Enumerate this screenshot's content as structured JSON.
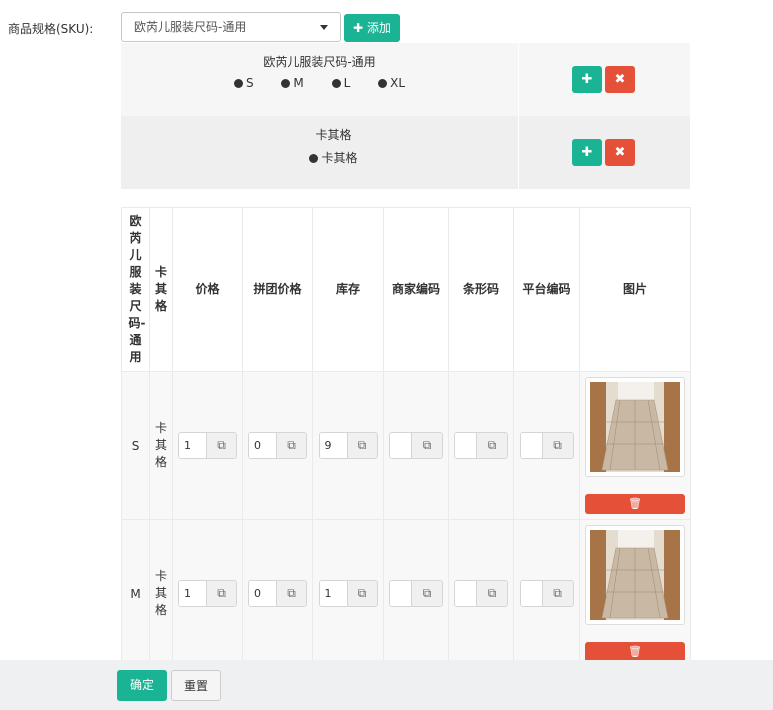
{
  "form": {
    "label": "商品规格(SKU):",
    "select_value": "欧芮儿服装尺码-通用",
    "add_label": "添加"
  },
  "specs": [
    {
      "title": "欧芮儿服装尺码-通用",
      "values": [
        "S",
        "M",
        "L",
        "XL"
      ]
    },
    {
      "title": "卡其格",
      "values": [
        "卡其格"
      ]
    }
  ],
  "table": {
    "headers": [
      "欧芮儿服装尺码-通用",
      "卡其格",
      "价格",
      "拼团价格",
      "库存",
      "商家编码",
      "条形码",
      "平台编码",
      "图片"
    ],
    "rows": [
      {
        "size": "S",
        "color": "卡其格",
        "price": "1",
        "group_price": "0",
        "stock": "9",
        "merchant_code": "",
        "barcode": "",
        "platform_code": ""
      },
      {
        "size": "M",
        "color": "卡其格",
        "price": "1",
        "group_price": "0",
        "stock": "1",
        "merchant_code": "",
        "barcode": "",
        "platform_code": ""
      }
    ]
  },
  "footer": {
    "confirm_label": "确定",
    "reset_label": "重置"
  },
  "colors": {
    "accent": "#1ab394",
    "danger": "#e55039",
    "panel": "#f5f5f5"
  }
}
